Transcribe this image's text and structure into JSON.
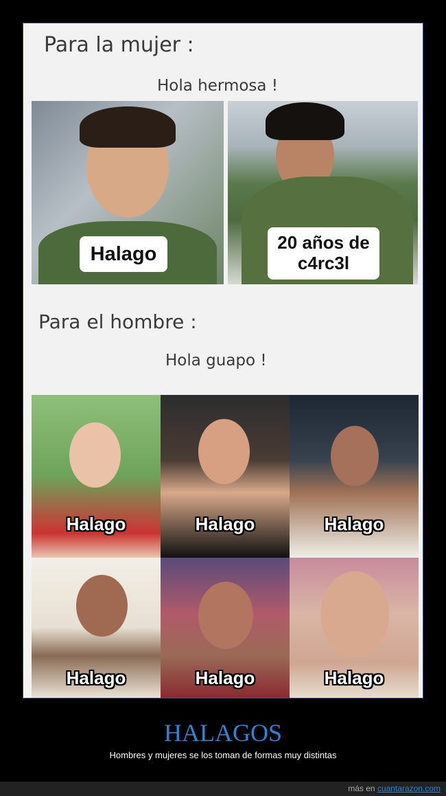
{
  "meme": {
    "woman_heading": "Para la mujer :",
    "woman_greeting": "Hola hermosa !",
    "label_flattery_1": "Halago",
    "label_prison_line1": "20 años de",
    "label_prison_line2": "c4rc3l",
    "man_heading": "Para el hombre :",
    "man_greeting": "Hola guapo !",
    "tile_labels": [
      "Halago",
      "Halago",
      "Halago",
      "Halago",
      "Halago",
      "Halago"
    ]
  },
  "post": {
    "title": "HALAGOS",
    "subtitle": "Hombres y mujeres se los toman de formas muy distintas"
  },
  "footer": {
    "prefix": "más en",
    "link": "cuantarazon.com"
  },
  "colors": {
    "title": "#2b86d6",
    "link": "#2b86d6",
    "background": "#000000",
    "meme_background": "#f2f2f2"
  }
}
